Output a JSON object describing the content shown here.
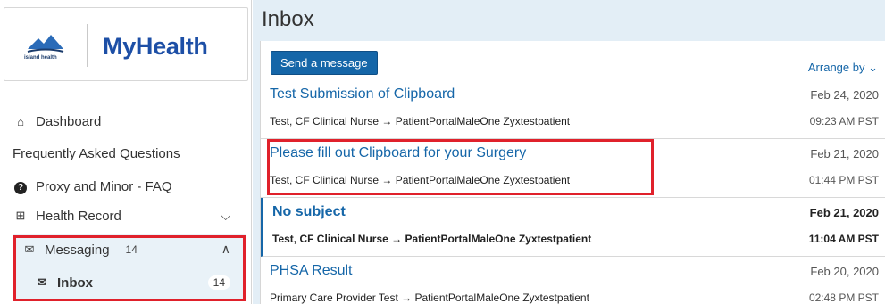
{
  "sidebar": {
    "logo_small_text": "island health",
    "logo_title": "MyHealth",
    "items": [
      {
        "icon": "home-icon",
        "icon_glyph": "⌂",
        "label": "Dashboard"
      },
      {
        "label": "Frequently Asked Questions"
      },
      {
        "icon": "question-circle-icon",
        "icon_glyph": "?",
        "label": "Proxy and Minor - FAQ"
      },
      {
        "icon": "medical-record-icon",
        "icon_glyph": "⊞",
        "label": "Health Record",
        "chevron": "⌵"
      },
      {
        "icon": "envelope-icon",
        "icon_glyph": "✉",
        "label": "Messaging",
        "badge": "14",
        "chevron": "∧"
      },
      {
        "icon": "envelope-open-icon",
        "icon_glyph": "✉",
        "label": "Inbox",
        "badge": "14"
      }
    ]
  },
  "main": {
    "title": "Inbox",
    "send_button": "Send a message",
    "arrange_by": "Arrange by ⌄"
  },
  "messages": [
    {
      "subject": "Test Submission of Clipboard",
      "date": "Feb 24, 2020",
      "from": "Test, CF Clinical Nurse → PatientPortalMaleOne Zyxtestpatient",
      "time": "09:23 AM PST"
    },
    {
      "subject": "Please fill out Clipboard for your Surgery",
      "date": "Feb 21, 2020",
      "from": "Test, CF Clinical Nurse → PatientPortalMaleOne Zyxtestpatient",
      "time": "01:44 PM PST"
    },
    {
      "subject": "No subject",
      "date": "Feb 21, 2020",
      "from": "Test, CF Clinical Nurse → PatientPortalMaleOne Zyxtestpatient",
      "time": "11:04 AM PST"
    },
    {
      "subject": "PHSA Result",
      "date": "Feb 20, 2020",
      "from": "Primary Care Provider Test → PatientPortalMaleOne Zyxtestpatient",
      "time": "02:48 PM PST"
    }
  ],
  "colors": {
    "accent": "#1566a8",
    "highlight": "#e0212b",
    "main_bg": "#e3eef6"
  }
}
